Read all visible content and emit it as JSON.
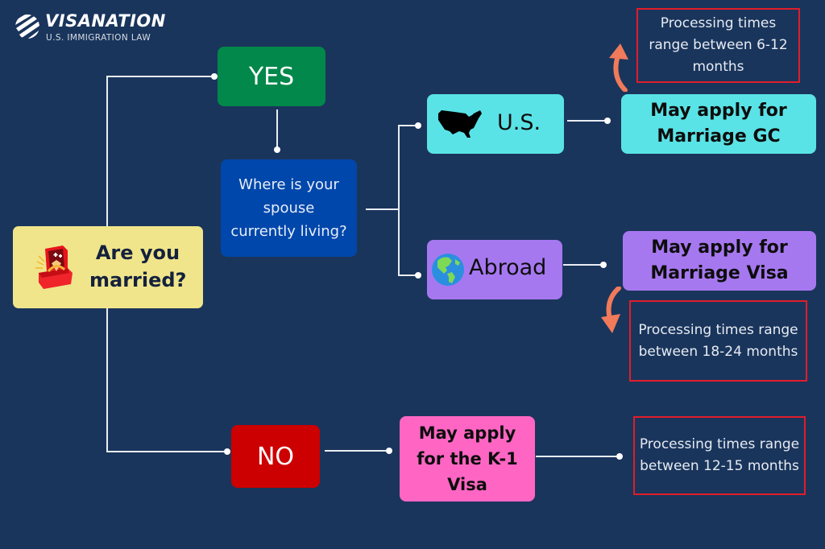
{
  "logo": {
    "title": "VISANATION",
    "subtitle": "U.S. IMMIGRATION LAW",
    "icon": "globe-stripes-icon"
  },
  "colors": {
    "background": "#1a355c",
    "start": "#f0e58a",
    "yes": "#02884a",
    "no": "#cc0000",
    "question": "#0047ab",
    "us": "#5ae3e6",
    "abroad": "#a678f0",
    "k1": "#ff66c4",
    "note_border": "#e11d2a",
    "arrow": "#f07a5a"
  },
  "nodes": {
    "start": {
      "label": "Are you married?",
      "icon": "engagement-ring-icon"
    },
    "yes": {
      "label": "YES"
    },
    "no": {
      "label": "NO"
    },
    "question": {
      "label": "Where is your spouse currently living?"
    },
    "us": {
      "label": "U.S.",
      "icon": "usa-map-icon"
    },
    "abroad": {
      "label": "Abroad",
      "icon": "globe-americas-icon"
    },
    "marriage_gc": {
      "label": "May apply for Marriage GC"
    },
    "marriage_visa": {
      "label": "May apply for Marriage Visa"
    },
    "k1": {
      "label": "May apply for the K-1 Visa"
    }
  },
  "notes": {
    "gc": "Processing times range between 6-12 months",
    "visa": "Processing times range between 18-24 months",
    "k1": "Processing times range between 12-15 months"
  }
}
